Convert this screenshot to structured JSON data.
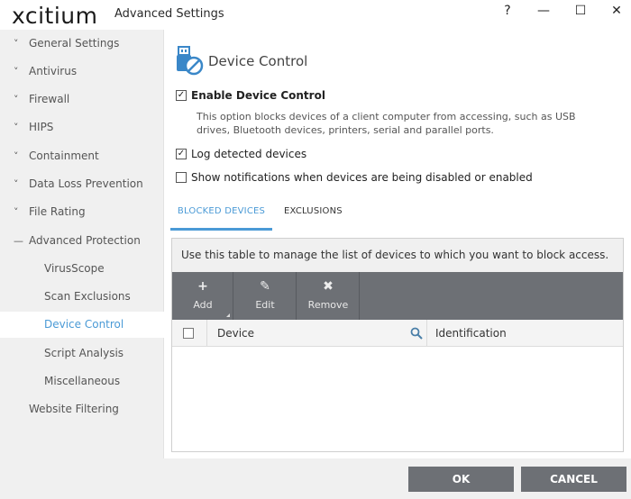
{
  "window": {
    "logo": "xcitium",
    "title": "Advanced Settings",
    "help_glyph": "?",
    "minimize_glyph": "—",
    "maximize_glyph": "☐",
    "close_glyph": "✕"
  },
  "sidebar": {
    "items": [
      {
        "label": "General Settings",
        "chevron": "˅"
      },
      {
        "label": "Antivirus",
        "chevron": "˅"
      },
      {
        "label": "Firewall",
        "chevron": "˅"
      },
      {
        "label": "HIPS",
        "chevron": "˅"
      },
      {
        "label": "Containment",
        "chevron": "˅"
      },
      {
        "label": "Data Loss Prevention",
        "chevron": "˅"
      },
      {
        "label": "File Rating",
        "chevron": "˅"
      },
      {
        "label": "Advanced Protection",
        "chevron": "—"
      },
      {
        "label": "VirusScope"
      },
      {
        "label": "Scan Exclusions"
      },
      {
        "label": "Device Control"
      },
      {
        "label": "Script Analysis"
      },
      {
        "label": "Miscellaneous"
      },
      {
        "label": "Website Filtering"
      }
    ],
    "active_item": "Device Control"
  },
  "main": {
    "title": "Device Control",
    "icon": "usb-blocked-icon",
    "enable": {
      "label": "Enable Device Control",
      "checked": true,
      "mark": "✓"
    },
    "description": "This option blocks devices of a client computer from accessing, such as USB drives, Bluetooth devices, printers, serial and parallel ports.",
    "log": {
      "label": "Log detected devices",
      "checked": true,
      "mark": "✓"
    },
    "notify": {
      "label": "Show notifications when devices are being disabled or enabled",
      "checked": false,
      "mark": ""
    },
    "tabs": [
      {
        "label": "BLOCKED DEVICES",
        "active": true
      },
      {
        "label": "EXCLUSIONS",
        "active": false
      }
    ],
    "panel": {
      "description": "Use this table to manage the list of devices to which you want to block access.",
      "toolbar": [
        {
          "label": "Add",
          "icon": "plus-icon",
          "glyph": "+"
        },
        {
          "label": "Edit",
          "icon": "pencil-icon",
          "glyph": "✎"
        },
        {
          "label": "Remove",
          "icon": "x-icon",
          "glyph": "✖"
        }
      ],
      "columns": [
        "Device",
        "Identification"
      ],
      "rows": []
    }
  },
  "footer": {
    "ok_label": "OK",
    "cancel_label": "CANCEL"
  },
  "colors": {
    "accent": "#4a9ad6",
    "toolbar": "#6d7075",
    "sidebar_bg": "#f0f0f0",
    "button_bg": "#6d7075"
  }
}
